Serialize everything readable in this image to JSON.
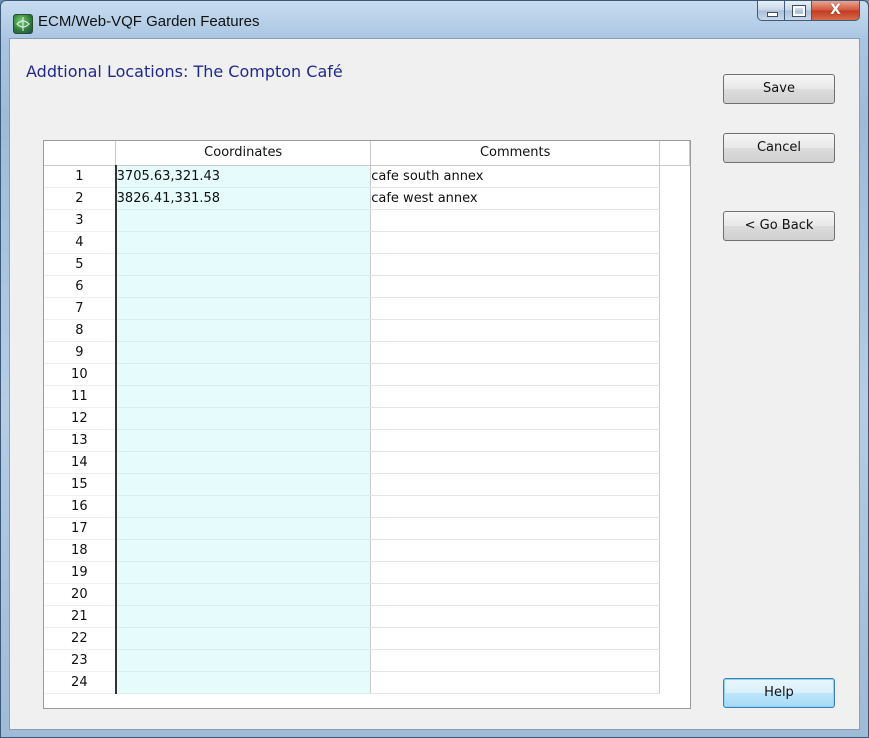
{
  "window": {
    "title": "ECM/Web-VQF Garden Features",
    "app_icon": "globe-icon"
  },
  "caption_buttons": {
    "close_glyph": "X"
  },
  "heading": "Addtional Locations: The Compton Café",
  "buttons": {
    "save": "Save",
    "cancel": "Cancel",
    "go_back": "< Go Back",
    "help": "Help"
  },
  "grid": {
    "columns": [
      "Coordinates",
      "Comments"
    ],
    "rows": [
      {
        "num": "1",
        "coordinates": "3705.63,321.43",
        "comments": "cafe south annex"
      },
      {
        "num": "2",
        "coordinates": "3826.41,331.58",
        "comments": "cafe west annex"
      },
      {
        "num": "3",
        "coordinates": "",
        "comments": ""
      },
      {
        "num": "4",
        "coordinates": "",
        "comments": ""
      },
      {
        "num": "5",
        "coordinates": "",
        "comments": ""
      },
      {
        "num": "6",
        "coordinates": "",
        "comments": ""
      },
      {
        "num": "7",
        "coordinates": "",
        "comments": ""
      },
      {
        "num": "8",
        "coordinates": "",
        "comments": ""
      },
      {
        "num": "9",
        "coordinates": "",
        "comments": ""
      },
      {
        "num": "10",
        "coordinates": "",
        "comments": ""
      },
      {
        "num": "11",
        "coordinates": "",
        "comments": ""
      },
      {
        "num": "12",
        "coordinates": "",
        "comments": ""
      },
      {
        "num": "13",
        "coordinates": "",
        "comments": ""
      },
      {
        "num": "14",
        "coordinates": "",
        "comments": ""
      },
      {
        "num": "15",
        "coordinates": "",
        "comments": ""
      },
      {
        "num": "16",
        "coordinates": "",
        "comments": ""
      },
      {
        "num": "17",
        "coordinates": "",
        "comments": ""
      },
      {
        "num": "18",
        "coordinates": "",
        "comments": ""
      },
      {
        "num": "19",
        "coordinates": "",
        "comments": ""
      },
      {
        "num": "20",
        "coordinates": "",
        "comments": ""
      },
      {
        "num": "21",
        "coordinates": "",
        "comments": ""
      },
      {
        "num": "22",
        "coordinates": "",
        "comments": ""
      },
      {
        "num": "23",
        "coordinates": "",
        "comments": ""
      },
      {
        "num": "24",
        "coordinates": "",
        "comments": ""
      }
    ]
  },
  "colors": {
    "heading": "#1f2a8c",
    "coordinates_column": "#e6fbfb",
    "close_button": "#c13a20"
  }
}
